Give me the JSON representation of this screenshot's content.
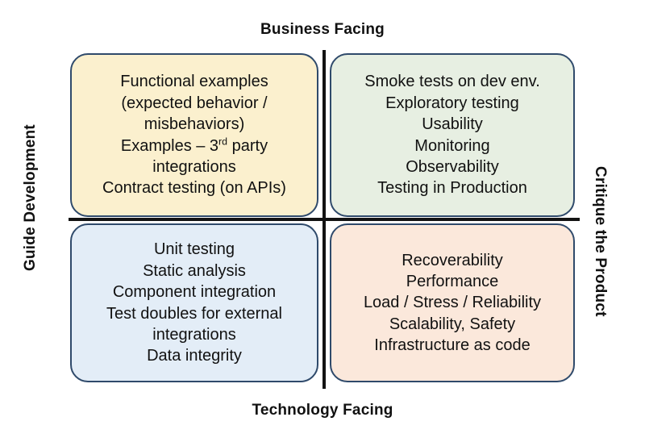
{
  "axes": {
    "top_label": "Business Facing",
    "bottom_label": "Technology Facing",
    "left_label": "Guide Development",
    "right_label": "Critique the Product"
  },
  "colors": {
    "top_left_fill": "#FBF0CE",
    "top_right_fill": "#E7EFE2",
    "bottom_left_fill": "#E3EDF7",
    "bottom_right_fill": "#FBE8DB",
    "box_border": "#2F4A6B",
    "axis_line": "#131313",
    "text": "#111111",
    "background": "#FFFFFF"
  },
  "chart_data": {
    "type": "table",
    "title": "Agile Testing Quadrants",
    "xlabel": "",
    "ylabel": "",
    "grid": false,
    "legend_position": "none",
    "x_axis": {
      "top": "Business Facing",
      "bottom": "Technology Facing"
    },
    "y_axis": {
      "left": "Guide Development",
      "right": "Critique the Product"
    },
    "quadrants": [
      {
        "position": "top-left",
        "x_category": "Business Facing",
        "y_category": "Guide Development",
        "fill": "#FBF0CE",
        "items": [
          {
            "text": "Functional examples"
          },
          {
            "text": "(expected behavior /"
          },
          {
            "text": "misbehaviors)"
          },
          {
            "text": "Examples – 3",
            "sup": "rd",
            "text_after": " party"
          },
          {
            "text": "integrations"
          },
          {
            "text": "Contract testing (on APIs)"
          }
        ]
      },
      {
        "position": "top-right",
        "x_category": "Business Facing",
        "y_category": "Critique the Product",
        "fill": "#E7EFE2",
        "items": [
          {
            "text": "Smoke tests on dev env."
          },
          {
            "text": "Exploratory testing"
          },
          {
            "text": "Usability"
          },
          {
            "text": "Monitoring"
          },
          {
            "text": "Observability"
          },
          {
            "text": "Testing in Production"
          }
        ]
      },
      {
        "position": "bottom-left",
        "x_category": "Technology Facing",
        "y_category": "Guide Development",
        "fill": "#E3EDF7",
        "items": [
          {
            "text": "Unit testing"
          },
          {
            "text": "Static analysis"
          },
          {
            "text": "Component integration"
          },
          {
            "text": "Test doubles for external"
          },
          {
            "text": "integrations"
          },
          {
            "text": "Data integrity"
          }
        ]
      },
      {
        "position": "bottom-right",
        "x_category": "Technology Facing",
        "y_category": "Critique the Product",
        "fill": "#FBE8DB",
        "items": [
          {
            "text": "Recoverability"
          },
          {
            "text": "Performance"
          },
          {
            "text": "Load / Stress / Reliability"
          },
          {
            "text": "Scalability, Safety"
          },
          {
            "text": "Infrastructure as code"
          }
        ]
      }
    ]
  }
}
